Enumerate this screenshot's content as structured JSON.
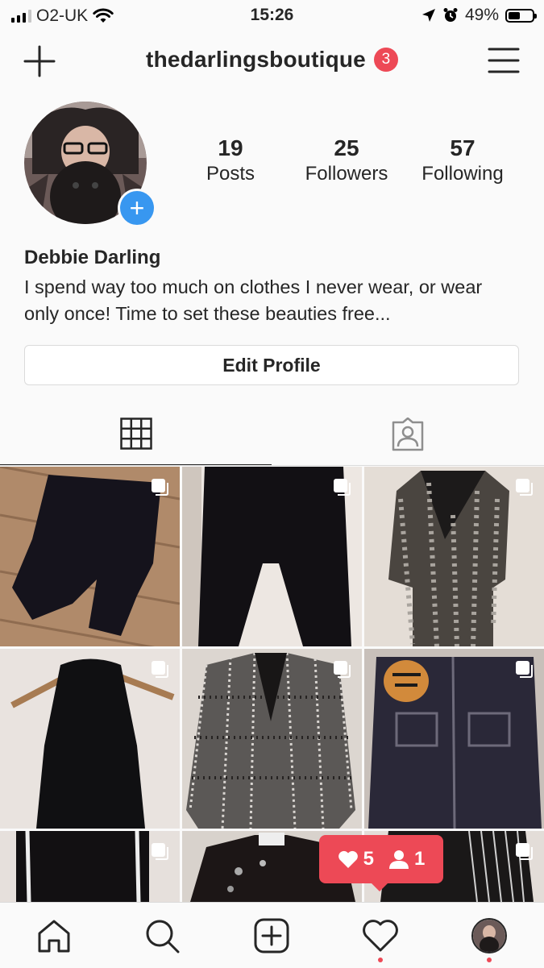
{
  "status_bar": {
    "carrier": "O2-UK",
    "time": "15:26",
    "battery": "49%",
    "battery_level": 0.49,
    "icons": [
      "signal-icon",
      "wifi-icon",
      "location-icon",
      "alarm-icon",
      "battery-icon"
    ]
  },
  "nav": {
    "username": "thedarlingsboutique",
    "notification_count": "3",
    "accent_color": "#ed4956"
  },
  "profile": {
    "stats": [
      {
        "value": "19",
        "label": "Posts"
      },
      {
        "value": "25",
        "label": "Followers"
      },
      {
        "value": "57",
        "label": "Following"
      }
    ],
    "name": "Debbie Darling",
    "bio": "I spend way too much on clothes I never wear, or wear only once! Time to set these beauties free...",
    "edit_button": "Edit Profile"
  },
  "tabs": [
    {
      "icon": "grid-icon",
      "active": true
    },
    {
      "icon": "tagged-icon",
      "active": false
    }
  ],
  "posts": [
    {
      "desc": "black cropped trousers on wooden floor",
      "multi": true
    },
    {
      "desc": "black culottes hanging on door",
      "multi": true
    },
    {
      "desc": "silver sequin blazer dress",
      "multi": true
    },
    {
      "desc": "black halter neck top on hanger",
      "multi": true
    },
    {
      "desc": "black and white tweed jacket",
      "multi": true
    },
    {
      "desc": "denim jacket with tiger embroidery",
      "multi": true
    },
    {
      "desc": "black trousers with white stripe",
      "multi": true
    },
    {
      "desc": "black leather jacket with pins",
      "multi": false
    },
    {
      "desc": "pinstripe jacket",
      "multi": true
    }
  ],
  "activity_popup": {
    "likes": "5",
    "follows": "1"
  },
  "bottom_nav": [
    "home-icon",
    "search-icon",
    "new-post-icon",
    "activity-icon",
    "profile-avatar"
  ]
}
